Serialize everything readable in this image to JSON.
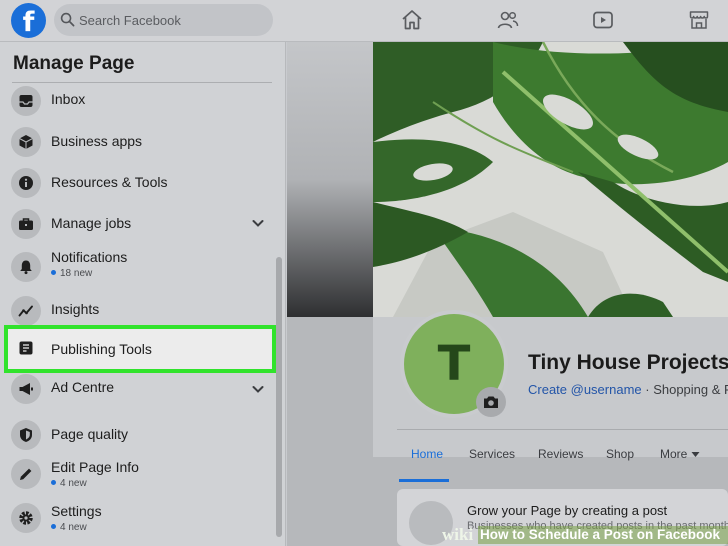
{
  "topbar": {
    "logo": "f",
    "search_placeholder": "Search Facebook",
    "nav_icons": [
      "home-icon",
      "friends-icon",
      "watch-icon",
      "marketplace-icon"
    ]
  },
  "sidebar": {
    "title": "Manage Page",
    "items": [
      {
        "label": "Inbox",
        "icon": "inbox-icon"
      },
      {
        "label": "Business apps",
        "icon": "cube-icon"
      },
      {
        "label": "Resources & Tools",
        "icon": "info-icon"
      },
      {
        "label": "Manage jobs",
        "icon": "briefcase-icon",
        "expandable": true
      },
      {
        "label": "Notifications",
        "icon": "bell-icon",
        "sub": "18 new"
      },
      {
        "label": "Insights",
        "icon": "trend-icon"
      },
      {
        "label": "Publishing Tools",
        "icon": "publishing-icon",
        "highlighted": true
      },
      {
        "label": "Ad Centre",
        "icon": "megaphone-icon",
        "expandable": true
      },
      {
        "label": "Page quality",
        "icon": "shield-icon"
      },
      {
        "label": "Edit Page Info",
        "icon": "pencil-icon",
        "sub": "4 new"
      },
      {
        "label": "Settings",
        "icon": "gear-icon",
        "sub": "4 new"
      }
    ]
  },
  "page": {
    "avatar_letter": "T",
    "name": "Tiny House Projects",
    "create_username": "Create @username",
    "category": " · Shopping & Retail",
    "tabs": [
      "Home",
      "Services",
      "Reviews",
      "Shop",
      "More"
    ],
    "active_tab": "Home"
  },
  "post_prompt": {
    "title": "Grow your Page by creating a post",
    "subtitle": "Businesses who have created posts in the past month, to creating a post"
  },
  "watermark": {
    "brand": "wiki",
    "text": "How to Schedule a Post on Facebook"
  },
  "colors": {
    "brand_blue": "#1a6ed8",
    "highlight_green": "#31e32c",
    "avatar_green": "#7fb05c"
  }
}
